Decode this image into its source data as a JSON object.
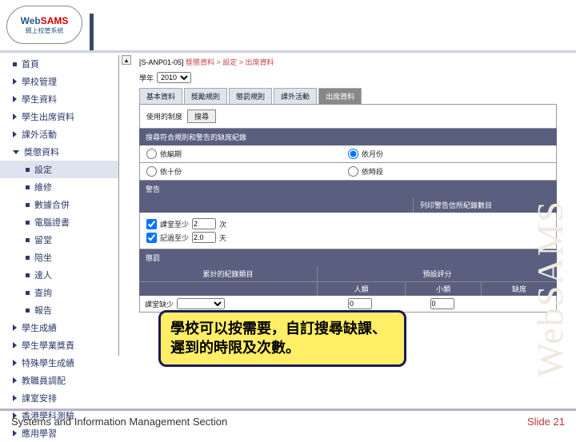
{
  "logo": {
    "brand1": "Web",
    "brand2": "SAMS",
    "sub": "網上校管系統"
  },
  "sidebar": {
    "top": [
      {
        "label": "首頁",
        "kind": "sq"
      },
      {
        "label": "學校管理",
        "kind": "tri"
      },
      {
        "label": "學生資料",
        "kind": "tri"
      },
      {
        "label": "學生出席資料",
        "kind": "tri"
      },
      {
        "label": "課外活動",
        "kind": "tri"
      },
      {
        "label": "獎懲資料",
        "kind": "dn"
      }
    ],
    "sub": [
      {
        "label": "設定",
        "active": true
      },
      {
        "label": "維修",
        "active": false
      },
      {
        "label": "數據合併",
        "active": false
      },
      {
        "label": "電腦證書",
        "active": false
      },
      {
        "label": "留堂",
        "active": false
      },
      {
        "label": "陪坐",
        "active": false
      },
      {
        "label": "達人",
        "active": false
      },
      {
        "label": "查詢",
        "active": false
      },
      {
        "label": "報告",
        "active": false
      }
    ],
    "bottom": [
      {
        "label": "學生成績"
      },
      {
        "label": "學生學業獎責"
      },
      {
        "label": "特殊學生成績"
      },
      {
        "label": "教職員調配"
      },
      {
        "label": "課室安排"
      },
      {
        "label": "香港學科測驗"
      },
      {
        "label": "應用學習"
      }
    ]
  },
  "crumb": {
    "code": "[S-ANP01-05]",
    "path": "獎懲資料 > 設定 > 出席資料"
  },
  "year": {
    "label": "學年",
    "value": "2010"
  },
  "tabs": [
    "基本資料",
    "獎勵規則",
    "懲罰規則",
    "課外活動",
    "出席資料"
  ],
  "section1": {
    "label": "使用的制度",
    "search_btn": "搜尋"
  },
  "section2_title": "搜尋符合規則和警告的缺席紀錄",
  "radios": {
    "r1": "依編期",
    "r2": "依月份",
    "r3": "依十份",
    "r4": "依時段"
  },
  "warn_title": "警告",
  "warn_col2": "列印警告信所紀錄數目",
  "warn_rows": {
    "row1_label": "課堂至少",
    "row1_val": "2",
    "row1_unit": "次",
    "row2_label": "記過至少",
    "row2_val": "2.0",
    "row2_unit": "天"
  },
  "punish_title": "懲罰",
  "table": {
    "th1": "累計的紀錄類目",
    "th2": "預設評分",
    "sub_a": "人類",
    "sub_b": "小類",
    "sub_c": "缺席",
    "row_label": "課堂缺少",
    "row_val": "0",
    "row_val2": "0"
  },
  "callout_text": "學校可以按需要，自訂搜尋缺課、遲到的時限及次數。",
  "watermark": "WebSAMS",
  "footer": {
    "left": "Systems and Information Management Section",
    "right_a": "Slide",
    "right_b": "21"
  }
}
